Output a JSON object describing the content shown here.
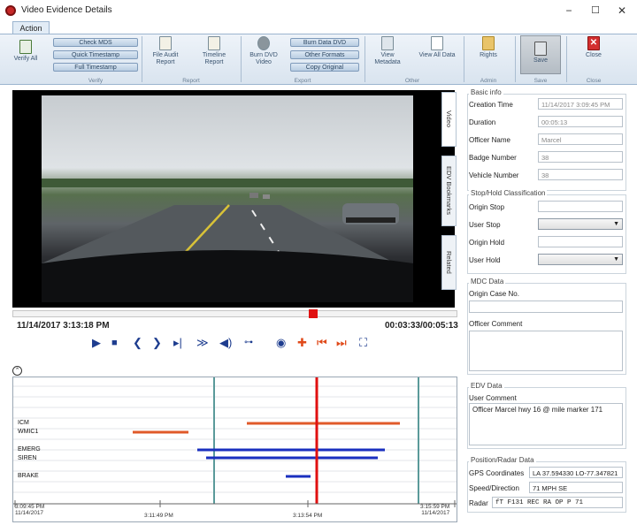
{
  "window": {
    "title": "Video Evidence Details",
    "minimize": "−",
    "maximize": "☐",
    "close": "✕"
  },
  "ribbon_tab": "Action",
  "ribbon": {
    "verify_all": "Verify All",
    "check_mds": "Check MDS",
    "quick_timestamp": "Quick Timestamp",
    "full_timestamp": "Full Timestamp",
    "file_audit_report": "File Audit Report",
    "timeline_report": "Timeline Report",
    "burn_dvd_video": "Burn DVD Video",
    "burn_data_dvd": "Burn Data DVD",
    "other_formats": "Other Formats",
    "copy_original": "Copy Original",
    "view_metadata": "View Metadata",
    "view_all_data": "View All Data",
    "rights": "Rights",
    "save": "Save",
    "close": "Close",
    "groups": {
      "verify": "Verify",
      "report": "Report",
      "export": "Export",
      "other": "Other",
      "admin": "Admin",
      "save": "Save",
      "close": "Close"
    }
  },
  "video_tabs": {
    "video": "Video",
    "bookmarks": "EDV Bookmarks",
    "related": "Related"
  },
  "player": {
    "timestamp": "11/14/2017  3:13:18 PM",
    "position": "00:03:33/00:05:13",
    "progress": 0.68
  },
  "timeline": {
    "labels": [
      "ICM",
      "WMIC1",
      "EMERG",
      "SIREN",
      "BRAKE"
    ],
    "ticks": [
      "3:09:45 PM\n11/14/2017",
      "3:11:49 PM",
      "3:13:54 PM",
      "3:15:59 PM\n11/14/2017"
    ]
  },
  "basic_info": {
    "title": "Basic info",
    "creation_time_label": "Creation Time",
    "creation_time": "11/14/2017 3:09:45 PM",
    "duration_label": "Duration",
    "duration": "00:05:13",
    "officer_name_label": "Officer Name",
    "officer_name": "Marcel",
    "badge_number_label": "Badge Number",
    "badge_number": "38",
    "vehicle_number_label": "Vehicle Number",
    "vehicle_number": "38"
  },
  "stop_hold": {
    "title": "Stop/Hold Classification",
    "origin_stop_label": "Origin Stop",
    "user_stop_label": "User Stop",
    "origin_hold_label": "Origin Hold",
    "user_hold_label": "User Hold"
  },
  "mdc": {
    "title": "MDC Data",
    "origin_case_label": "Origin Case No.",
    "officer_comment_label": "Officer Comment"
  },
  "edv": {
    "title": "EDV Data",
    "user_comment_label": "User Comment",
    "user_comment": "Officer Marcel hwy 16 @ mile marker 171"
  },
  "position_radar": {
    "title": "Position/Radar Data",
    "gps_label": "GPS Coordinates",
    "gps": "LA 37.594330 LO-77.347821",
    "speed_label": "Speed/Direction",
    "speed": "71 MPH SE",
    "radar_label": "Radar",
    "radar": "fT F131 REC RA OP  P 71"
  }
}
